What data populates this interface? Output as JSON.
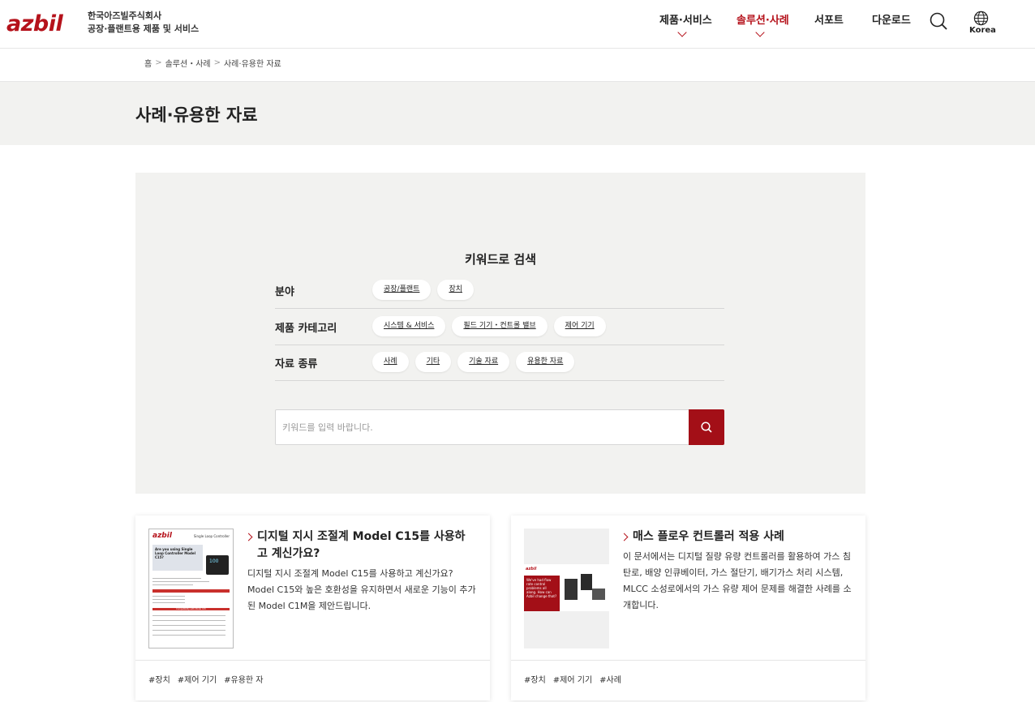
{
  "header": {
    "logo_text": "azbil",
    "company_name": "한국아즈빌주식회사",
    "company_tagline": "공장·플랜트용 제품 및 서비스",
    "nav": [
      {
        "label": "제품·서비스",
        "active": false
      },
      {
        "label": "솔루션·사례",
        "active": true
      },
      {
        "label": "서포트",
        "active": false
      },
      {
        "label": "다운로드",
        "active": false
      }
    ],
    "search_icon": "search-icon",
    "globe_icon": "globe-icon",
    "language": "Korea"
  },
  "breadcrumb": [
    "홈",
    "솔루션・사례",
    "사례·유용한 자료"
  ],
  "page_title": "사례·유용한 자료",
  "search": {
    "heading": "키워드로 검색",
    "filters": [
      {
        "label": "분야",
        "chips": [
          "공장/플랜트",
          "장치"
        ]
      },
      {
        "label": "제품 카테고리",
        "chips": [
          "시스템 & 서비스",
          "필드 기기・컨트롤 밸브",
          "제어 기기"
        ]
      },
      {
        "label": "자료 종류",
        "chips": [
          "사례",
          "기타",
          "기술 자료",
          "유용한 자료"
        ]
      }
    ],
    "placeholder": "키워드를 입력 바랍니다.",
    "button_icon": "search-icon"
  },
  "cards": [
    {
      "title": "디지털 지시 조절계 Model C15를 사용하고 계신가요?",
      "description": "디지털 지시 조절계 Model C15를 사용하고 계신가요? Model C15와 높은 호환성을 유지하면서 새로운 기능이 추가된 Model C1M을 제안드립니다.",
      "tags": [
        "#장치",
        "#제어 기기",
        "#유용한 자"
      ],
      "thumb": {
        "logo": "azbil",
        "header": "Single Loop Controller",
        "headline": "Are you using Single Loop Controller Model C15?",
        "device_display": "100",
        "band": "Compatibility with Model C15"
      }
    },
    {
      "title": "매스 플로우 컨트롤러 적용 사례",
      "description": "이 문서에서는 디지털 질량 유량 컨트롤러를 활용하여 가스 침탄로, 배양 인큐베이터, 가스 절단기, 배기가스 처리 시스템, MLCC 소성로에서의 가스 유량 제어 문제를 해결한 사례를 소개합니다.",
      "tags": [
        "#장치",
        "#제어 기기",
        "#사례"
      ],
      "thumb": {
        "logo": "azbil",
        "red_text": "We've had flow rate control problems all along. How can Azbil change that?"
      }
    }
  ],
  "colors": {
    "brand_red": "#b5121b",
    "button_red": "#a30f17",
    "panel_gray": "#f2f2f0"
  }
}
